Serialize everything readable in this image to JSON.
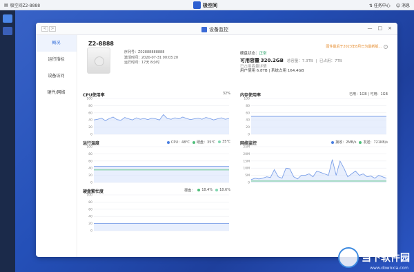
{
  "topbar": {
    "left_label": "极空间Z2-8888",
    "app_name": "极空间",
    "task_center": "任务中心",
    "messages": "消息"
  },
  "window": {
    "title": "设备监控",
    "nav_back": "<",
    "nav_forward": ">",
    "ctrl_min": "—",
    "ctrl_max": "□",
    "ctrl_close": "×"
  },
  "leftnav": [
    {
      "label": "概况"
    },
    {
      "label": "运行指标"
    },
    {
      "label": "设备访问"
    },
    {
      "label": "硬件/网络"
    }
  ],
  "device": {
    "name": "Z2-8888",
    "serial": "序列号：Z02888888888",
    "activated": "激活时间：2020-07-31 00:03:20",
    "uptime": "运行时间：17天 8小时"
  },
  "status": {
    "label": "硬盘状态：",
    "value": "正常",
    "capacity_label": "可用容量",
    "capacity_value": "320.2GB",
    "total": "总容量：7.3TB",
    "used": "已占用：7TB",
    "user_usage_title": "已占用容量详情",
    "user_usage": "用户使用 6.8TB | 系统占用 164.4GB"
  },
  "notice": "固件最后于2023年8月已为最新版...",
  "panels": {
    "cpu": {
      "title": "CPU使用率",
      "legend": "32%"
    },
    "mem": {
      "title": "内存使用率",
      "legend": "已用：1GB | 可用：1GB"
    },
    "temp": {
      "title": "运行温度",
      "legend": [
        "CPU：48℃",
        "硬盘：35℃",
        "35℃"
      ]
    },
    "net": {
      "title": "网络监控",
      "legend": [
        "接收：2MB/s",
        "发送：721KB/s"
      ]
    },
    "disk": {
      "title": "硬盘繁忙度",
      "legend": [
        "硬盘：",
        "18.4%",
        "18.6%"
      ]
    }
  },
  "chart_data": [
    {
      "type": "line",
      "title": "CPU使用率",
      "y_ticks": [
        "100",
        "80",
        "60",
        "40",
        "20",
        "0"
      ],
      "ylim": [
        0,
        100
      ],
      "series": [
        {
          "values": [
            40,
            42,
            45,
            38,
            44,
            48,
            41,
            39,
            47,
            43,
            40,
            46,
            42,
            44,
            41,
            45,
            43,
            40,
            55,
            44,
            42,
            46,
            43,
            48,
            44,
            41,
            43,
            45,
            42,
            47,
            44,
            40,
            43,
            46,
            42,
            44
          ]
        }
      ]
    },
    {
      "type": "line",
      "title": "内存使用率",
      "y_ticks": [
        "100",
        "80",
        "60",
        "40",
        "20",
        "0"
      ],
      "ylim": [
        0,
        100
      ],
      "series": [
        {
          "values": [
            50,
            50,
            50,
            50,
            50,
            50,
            50,
            50,
            50,
            50,
            50,
            50,
            50,
            50,
            50,
            50,
            50,
            50,
            50,
            50,
            50,
            50,
            50,
            50,
            50,
            50,
            50,
            50,
            50,
            50,
            50,
            50,
            50,
            50,
            50,
            50
          ]
        }
      ]
    },
    {
      "type": "line",
      "title": "运行温度",
      "y_ticks": [
        "100",
        "80",
        "60",
        "40",
        "20",
        "0"
      ],
      "ylim": [
        0,
        100
      ],
      "series": [
        {
          "values": [
            45,
            45,
            45,
            45,
            45,
            45,
            45,
            45,
            45,
            45,
            45,
            45,
            45,
            45,
            45,
            45,
            45,
            45,
            45,
            45,
            45,
            45,
            45,
            45,
            45,
            45,
            45,
            45,
            45,
            45,
            45,
            45,
            45,
            45,
            45,
            45
          ]
        },
        {
          "values": [
            35,
            35,
            35,
            35,
            35,
            35,
            35,
            35,
            35,
            35,
            35,
            35,
            35,
            35,
            35,
            35,
            35,
            35,
            35,
            35,
            35,
            35,
            35,
            35,
            35,
            35,
            35,
            35,
            35,
            35,
            35,
            35,
            35,
            35,
            35,
            35
          ]
        }
      ]
    },
    {
      "type": "line",
      "title": "网络监控",
      "y_ticks": [
        "25M",
        "20M",
        "15M",
        "10M",
        "5M",
        "0"
      ],
      "ylim": [
        0,
        25
      ],
      "series": [
        {
          "values": [
            2,
            3,
            2.5,
            3,
            4,
            3.5,
            9,
            4,
            3,
            10,
            9.5,
            4,
            2.5,
            5,
            5,
            6,
            4,
            8,
            7,
            6,
            5,
            16,
            5,
            15,
            10,
            4,
            6,
            8,
            5,
            6,
            4,
            4.5,
            3,
            5,
            4,
            3
          ]
        },
        {
          "values": [
            1,
            1,
            1,
            1,
            1,
            1,
            1,
            1,
            1,
            1,
            1,
            1,
            1,
            1,
            1,
            1,
            1,
            1,
            1,
            1,
            1,
            1,
            1,
            1,
            1,
            1,
            1,
            1,
            1,
            1,
            1,
            1,
            1,
            1,
            1,
            1
          ]
        }
      ]
    },
    {
      "type": "line",
      "title": "硬盘繁忙度",
      "y_ticks": [
        "100",
        "80",
        "60",
        "40",
        "20",
        "0"
      ],
      "ylim": [
        0,
        100
      ],
      "series": [
        {
          "values": [
            20,
            20,
            20,
            20,
            20,
            20,
            20,
            20,
            20,
            20,
            20,
            20,
            20,
            20,
            20,
            20,
            20,
            20,
            20,
            20,
            20,
            20,
            20,
            20,
            20,
            20,
            20,
            20,
            20,
            20,
            20,
            20,
            20,
            20,
            20,
            20
          ]
        }
      ]
    }
  ],
  "colors": {
    "accent": "#2d6ad8",
    "line_blue": "#7b9fe8",
    "line_green": "#4fbf7a",
    "fill_blue": "#d8e4fb"
  },
  "watermark": {
    "text": "当下软件园",
    "url": "www.downxia.com"
  }
}
